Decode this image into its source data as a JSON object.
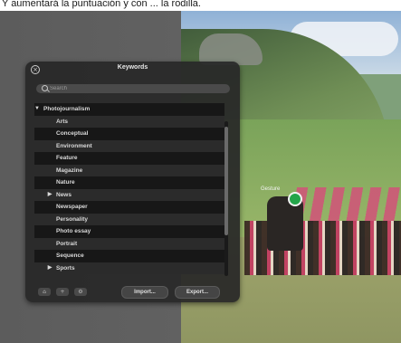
{
  "caption": {
    "text": "Y aumentará la puntuación y con ... la rodilla."
  },
  "photo": {
    "marker_label": "Gesture"
  },
  "panel": {
    "title": "Keywords",
    "close_icon": "close-icon",
    "search": {
      "placeholder": "Search",
      "value": ""
    },
    "keywords": [
      {
        "label": "Photojournalism",
        "level": 0,
        "expanded": true,
        "has_children": true
      },
      {
        "label": "Arts",
        "level": 1,
        "has_children": false
      },
      {
        "label": "Conceptual",
        "level": 1,
        "has_children": false
      },
      {
        "label": "Environment",
        "level": 1,
        "has_children": false
      },
      {
        "label": "Feature",
        "level": 1,
        "has_children": false
      },
      {
        "label": "Magazine",
        "level": 1,
        "has_children": false
      },
      {
        "label": "Nature",
        "level": 1,
        "has_children": false
      },
      {
        "label": "News",
        "level": 1,
        "expanded": false,
        "has_children": true
      },
      {
        "label": "Newspaper",
        "level": 1,
        "has_children": false
      },
      {
        "label": "Personality",
        "level": 1,
        "has_children": false
      },
      {
        "label": "Photo essay",
        "level": 1,
        "has_children": false
      },
      {
        "label": "Portrait",
        "level": 1,
        "has_children": false
      },
      {
        "label": "Sequence",
        "level": 1,
        "has_children": false
      },
      {
        "label": "Sports",
        "level": 1,
        "expanded": false,
        "has_children": true
      }
    ],
    "toolbar": {
      "tools": [
        {
          "icon": "keyword-tag-icon"
        },
        {
          "icon": "add-icon"
        },
        {
          "icon": "gear-icon"
        }
      ],
      "import_label": "Import...",
      "export_label": "Export..."
    }
  }
}
